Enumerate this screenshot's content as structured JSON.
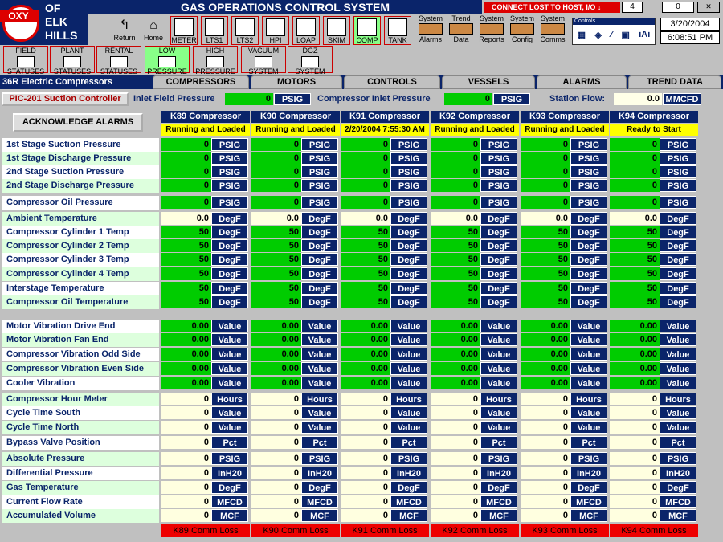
{
  "logo": {
    "badge": "OXY",
    "lines": [
      "OF",
      "ELK",
      "HILLS"
    ]
  },
  "title": "GAS OPERATIONS CONTROL SYSTEM",
  "alarm_banner": "CONNECT LOST TO HOST, I/O",
  "alarm_count": "4",
  "right_count": "0",
  "date": "3/20/2004",
  "time": "6:08:51 PM",
  "nav": [
    {
      "label": "Return",
      "icon": "return-arrow-icon"
    },
    {
      "label": "Home",
      "icon": "home-icon"
    }
  ],
  "tools": [
    {
      "label": "METER",
      "sel": false
    },
    {
      "label": "LTS1",
      "sel": false
    },
    {
      "label": "LTS2",
      "sel": false
    },
    {
      "label": "HPI",
      "sel": false
    },
    {
      "label": "LOAP",
      "sel": false
    },
    {
      "label": "SKIM",
      "sel": false
    },
    {
      "label": "COMP",
      "sel": true
    },
    {
      "label": "TANK",
      "sel": false
    }
  ],
  "system": [
    {
      "top": "System",
      "bottom": "Alarms"
    },
    {
      "top": "Trend",
      "bottom": "Data"
    },
    {
      "top": "System",
      "bottom": "Reports"
    },
    {
      "top": "System",
      "bottom": "Config"
    },
    {
      "top": "System",
      "bottom": "Comms"
    }
  ],
  "controls_title": "Controls",
  "categories": [
    {
      "l1": "FIELD",
      "l2": "STATUSES",
      "sel": false
    },
    {
      "l1": "PLANT",
      "l2": "STATUSES",
      "sel": false
    },
    {
      "l1": "RENTAL",
      "l2": "STATUSES",
      "sel": false
    },
    {
      "l1": "LOW",
      "l2": "PRESSURE",
      "sel": true
    },
    {
      "l1": "HIGH",
      "l2": "PRESSURE",
      "sel": false
    },
    {
      "l1": "VACUUM",
      "l2": "SYSTEM",
      "sel": false
    },
    {
      "l1": "DGZ",
      "l2": "SYSTEM",
      "sel": false
    }
  ],
  "section": "36R Electric Compressors",
  "tabs": [
    "COMPRESSORS",
    "MOTORS",
    "CONTROLS",
    "VESSELS",
    "ALARMS",
    "TREND DATA"
  ],
  "pic_button": "PIC-201 Suction Controller",
  "inlet_field": {
    "label": "Inlet Field Pressure",
    "value": "0",
    "unit": "PSIG"
  },
  "comp_inlet": {
    "label": "Compressor Inlet Pressure",
    "value": "0",
    "unit": "PSIG"
  },
  "station_flow": {
    "label": "Station Flow:",
    "value": "0.0",
    "unit": "MMCFD"
  },
  "ack_button": "ACKNOWLEDGE ALARMS",
  "compressors": [
    {
      "name": "K89 Compressor",
      "status": "Running and Loaded",
      "comm": "K89 Comm Loss"
    },
    {
      "name": "K90 Compressor",
      "status": "Running and Loaded",
      "comm": "K90 Comm Loss"
    },
    {
      "name": "K91 Compressor",
      "status": "2/20/2004   7:55:30 AM",
      "comm": "K91 Comm Loss"
    },
    {
      "name": "K92 Compressor",
      "status": "Running and Loaded",
      "comm": "K92 Comm Loss"
    },
    {
      "name": "K93 Compressor",
      "status": "Running and Loaded",
      "comm": "K93 Comm Loss"
    },
    {
      "name": "K94 Compressor",
      "status": "Ready to Start",
      "comm": "K94 Comm Loss"
    }
  ],
  "rows": [
    {
      "label": "1st Stage Suction Pressure",
      "value": "0",
      "unit": "PSIG",
      "color": "green",
      "bg": "w"
    },
    {
      "label": "1st Stage Discharge Pressure",
      "value": "0",
      "unit": "PSIG",
      "color": "green",
      "bg": "g"
    },
    {
      "label": "2nd Stage Suction Pressure",
      "value": "0",
      "unit": "PSIG",
      "color": "green",
      "bg": "w"
    },
    {
      "label": "2nd Stage Discharge Pressure",
      "value": "0",
      "unit": "PSIG",
      "color": "green",
      "bg": "g"
    },
    {
      "label": "Compressor Oil Pressure",
      "value": "0",
      "unit": "PSIG",
      "color": "green",
      "bg": "w"
    },
    {
      "label": "Ambient Temperature",
      "value": "0.0",
      "unit": "DegF",
      "color": "cream",
      "bg": "g"
    },
    {
      "label": "Compressor Cylinder 1 Temp",
      "value": "50",
      "unit": "DegF",
      "color": "green",
      "bg": "w"
    },
    {
      "label": "Compressor Cylinder 2 Temp",
      "value": "50",
      "unit": "DegF",
      "color": "green",
      "bg": "g"
    },
    {
      "label": "Compressor Cylinder 3 Temp",
      "value": "50",
      "unit": "DegF",
      "color": "green",
      "bg": "w"
    },
    {
      "label": "Compressor Cylinder 4 Temp",
      "value": "50",
      "unit": "DegF",
      "color": "green",
      "bg": "g"
    },
    {
      "label": "Interstage Temperature",
      "value": "50",
      "unit": "DegF",
      "color": "green",
      "bg": "w"
    },
    {
      "label": "Compressor Oil Temperature",
      "value": "50",
      "unit": "DegF",
      "color": "green",
      "bg": "g"
    },
    {
      "label": "Motor Vibration Drive End",
      "value": "0.00",
      "unit": "Value",
      "color": "green",
      "bg": "w"
    },
    {
      "label": "Motor Vibration Fan End",
      "value": "0.00",
      "unit": "Value",
      "color": "green",
      "bg": "g"
    },
    {
      "label": "Compressor Vibration Odd Side",
      "value": "0.00",
      "unit": "Value",
      "color": "green",
      "bg": "w"
    },
    {
      "label": "Compressor Vibration Even Side",
      "value": "0.00",
      "unit": "Value",
      "color": "green",
      "bg": "g"
    },
    {
      "label": "Cooler Vibration",
      "value": "0.00",
      "unit": "Value",
      "color": "green",
      "bg": "w"
    },
    {
      "label": "Compressor Hour Meter",
      "value": "0",
      "unit": "Hours",
      "color": "cream",
      "bg": "g"
    },
    {
      "label": "Cycle Time South",
      "value": "0",
      "unit": "Value",
      "color": "cream",
      "bg": "w"
    },
    {
      "label": "Cycle Time North",
      "value": "0",
      "unit": "Value",
      "color": "cream",
      "bg": "g"
    },
    {
      "label": "Bypass Valve Position",
      "value": "0",
      "unit": "Pct",
      "color": "cream",
      "bg": "w"
    },
    {
      "label": "Absolute Pressure",
      "value": "0",
      "unit": "PSIG",
      "color": "cream",
      "bg": "g"
    },
    {
      "label": "Differential Pressure",
      "value": "0",
      "unit": "InH20",
      "color": "cream",
      "bg": "w"
    },
    {
      "label": "Gas Temperature",
      "value": "0",
      "unit": "DegF",
      "color": "cream",
      "bg": "g"
    },
    {
      "label": "Current Flow Rate",
      "value": "0",
      "unit": "MFCD",
      "color": "cream",
      "bg": "w"
    },
    {
      "label": "Accumulated Volume",
      "value": "0",
      "unit": "MCF",
      "color": "cream",
      "bg": "g"
    }
  ]
}
